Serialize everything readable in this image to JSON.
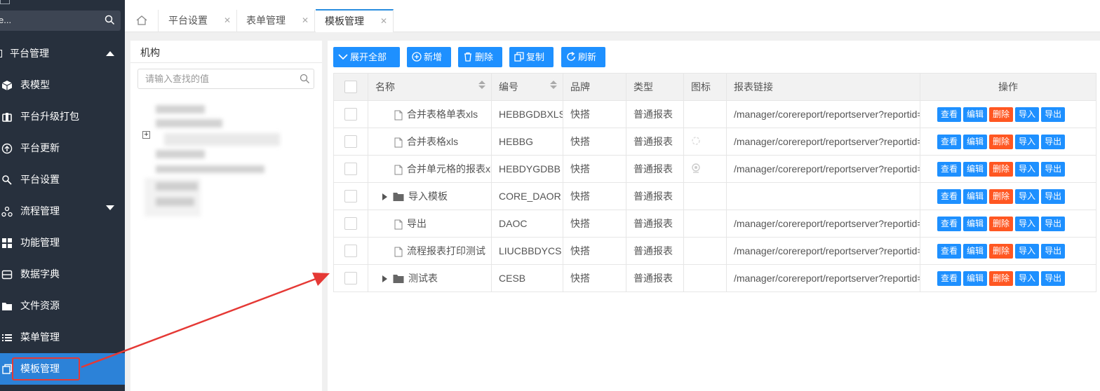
{
  "sidebar": {
    "search_value": "e...",
    "items": [
      {
        "label": "平台管理",
        "icon": "platform-icon"
      },
      {
        "label": "表模型",
        "icon": "cube-icon"
      },
      {
        "label": "平台升级打包",
        "icon": "package-icon"
      },
      {
        "label": "平台更新",
        "icon": "update-icon"
      },
      {
        "label": "平台设置",
        "icon": "settings-icon"
      },
      {
        "label": "流程管理",
        "icon": "workflow-icon"
      },
      {
        "label": "功能管理",
        "icon": "apps-icon"
      },
      {
        "label": "数据字典",
        "icon": "dictionary-icon"
      },
      {
        "label": "文件资源",
        "icon": "folder-icon"
      },
      {
        "label": "菜单管理",
        "icon": "list-icon"
      },
      {
        "label": "模板管理",
        "icon": "template-icon"
      }
    ]
  },
  "tabs": [
    {
      "label": "平台设置"
    },
    {
      "label": "表单管理"
    },
    {
      "label": "模板管理"
    }
  ],
  "left_panel": {
    "title": "机构",
    "search_placeholder": "请输入查找的值"
  },
  "toolbar": {
    "expand_all": "展开全部",
    "add": "新增",
    "delete": "删除",
    "copy": "复制",
    "refresh": "刷新"
  },
  "table": {
    "columns": [
      "名称",
      "编号",
      "品牌",
      "类型",
      "图标",
      "报表链接",
      "操作"
    ],
    "actions": {
      "view": "查看",
      "edit": "编辑",
      "delete": "删除",
      "import": "导入",
      "export": "导出"
    },
    "rows": [
      {
        "kind": "file",
        "name": "合并表格单表xls",
        "code": "HEBBGDBXLS",
        "brand": "快搭",
        "type": "普通报表",
        "link": "/manager/corereport/reportserver?reportid="
      },
      {
        "kind": "file",
        "name": "合并表格xls",
        "code": "HEBBG",
        "brand": "快搭",
        "type": "普通报表",
        "link": "/manager/corereport/reportserver?reportid="
      },
      {
        "kind": "file",
        "name": "合并单元格的报表xls",
        "code": "HEBDYGDBB",
        "brand": "快搭",
        "type": "普通报表",
        "link": "/manager/corereport/reportserver?reportid="
      },
      {
        "kind": "folder",
        "name": "导入模板",
        "code": "CORE_DAOR",
        "brand": "快搭",
        "type": "普通报表",
        "link": ""
      },
      {
        "kind": "file",
        "name": "导出",
        "code": "DAOC",
        "brand": "快搭",
        "type": "普通报表",
        "link": "/manager/corereport/reportserver?reportid="
      },
      {
        "kind": "file",
        "name": "流程报表打印测试",
        "code": "LIUCBBDYCS",
        "brand": "快搭",
        "type": "普通报表",
        "link": "/manager/corereport/reportserver?reportid="
      },
      {
        "kind": "folder",
        "name": "测试表",
        "code": "CESB",
        "brand": "快搭",
        "type": "普通报表",
        "link": "/manager/corereport/reportserver?reportid="
      }
    ]
  },
  "colors": {
    "sidebar_bg": "#27303d",
    "sidebar_active": "#2c82d8",
    "primary": "#1e90ff",
    "danger": "#ff5722",
    "annotation": "#e53935"
  }
}
